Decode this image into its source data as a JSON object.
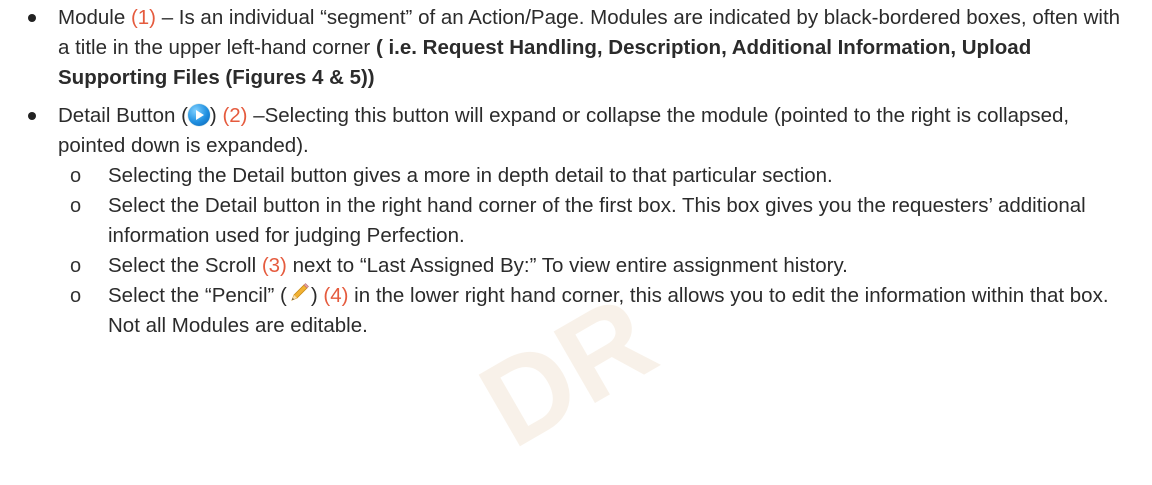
{
  "watermark": {
    "text": "DR"
  },
  "bullets": [
    {
      "pre": "Module ",
      "ref": "(1)",
      "text": " – Is an individual “segment” of an Action/Page. Modules are indicated by black-bordered boxes, often with a title in the upper left-hand corner ",
      "bold": "( i.e. Request Handling, Description, Additional Information, Upload Supporting Files (Figures 4 & 5))"
    },
    {
      "pre": "Detail Button (",
      "icon": "blue-play-icon",
      "mid": ") ",
      "ref": "(2)",
      "text": " –Selecting this button will expand or collapse the module (pointed to the right is collapsed, pointed down is expanded)."
    }
  ],
  "subs": [
    {
      "text": "Selecting the Detail button gives a more in depth detail to that particular section."
    },
    {
      "text": "Select the Detail button in the right hand corner of the first box. This box gives you the requesters’ additional information used for judging Perfection."
    },
    {
      "pre": "Select the Scroll ",
      "ref": "(3)",
      "text": " next to “Last Assigned By:” To view entire assignment history."
    },
    {
      "pre": "Select the “Pencil” (",
      "icon": "pencil-icon",
      "mid": ") ",
      "ref": "(4)",
      "text": " in the lower right hand corner, this allows you to edit the information within that box. Not all Modules are editable."
    }
  ],
  "sub_marker": "o",
  "colors": {
    "ref": "#e55b3e",
    "text": "#2b2b2b"
  }
}
